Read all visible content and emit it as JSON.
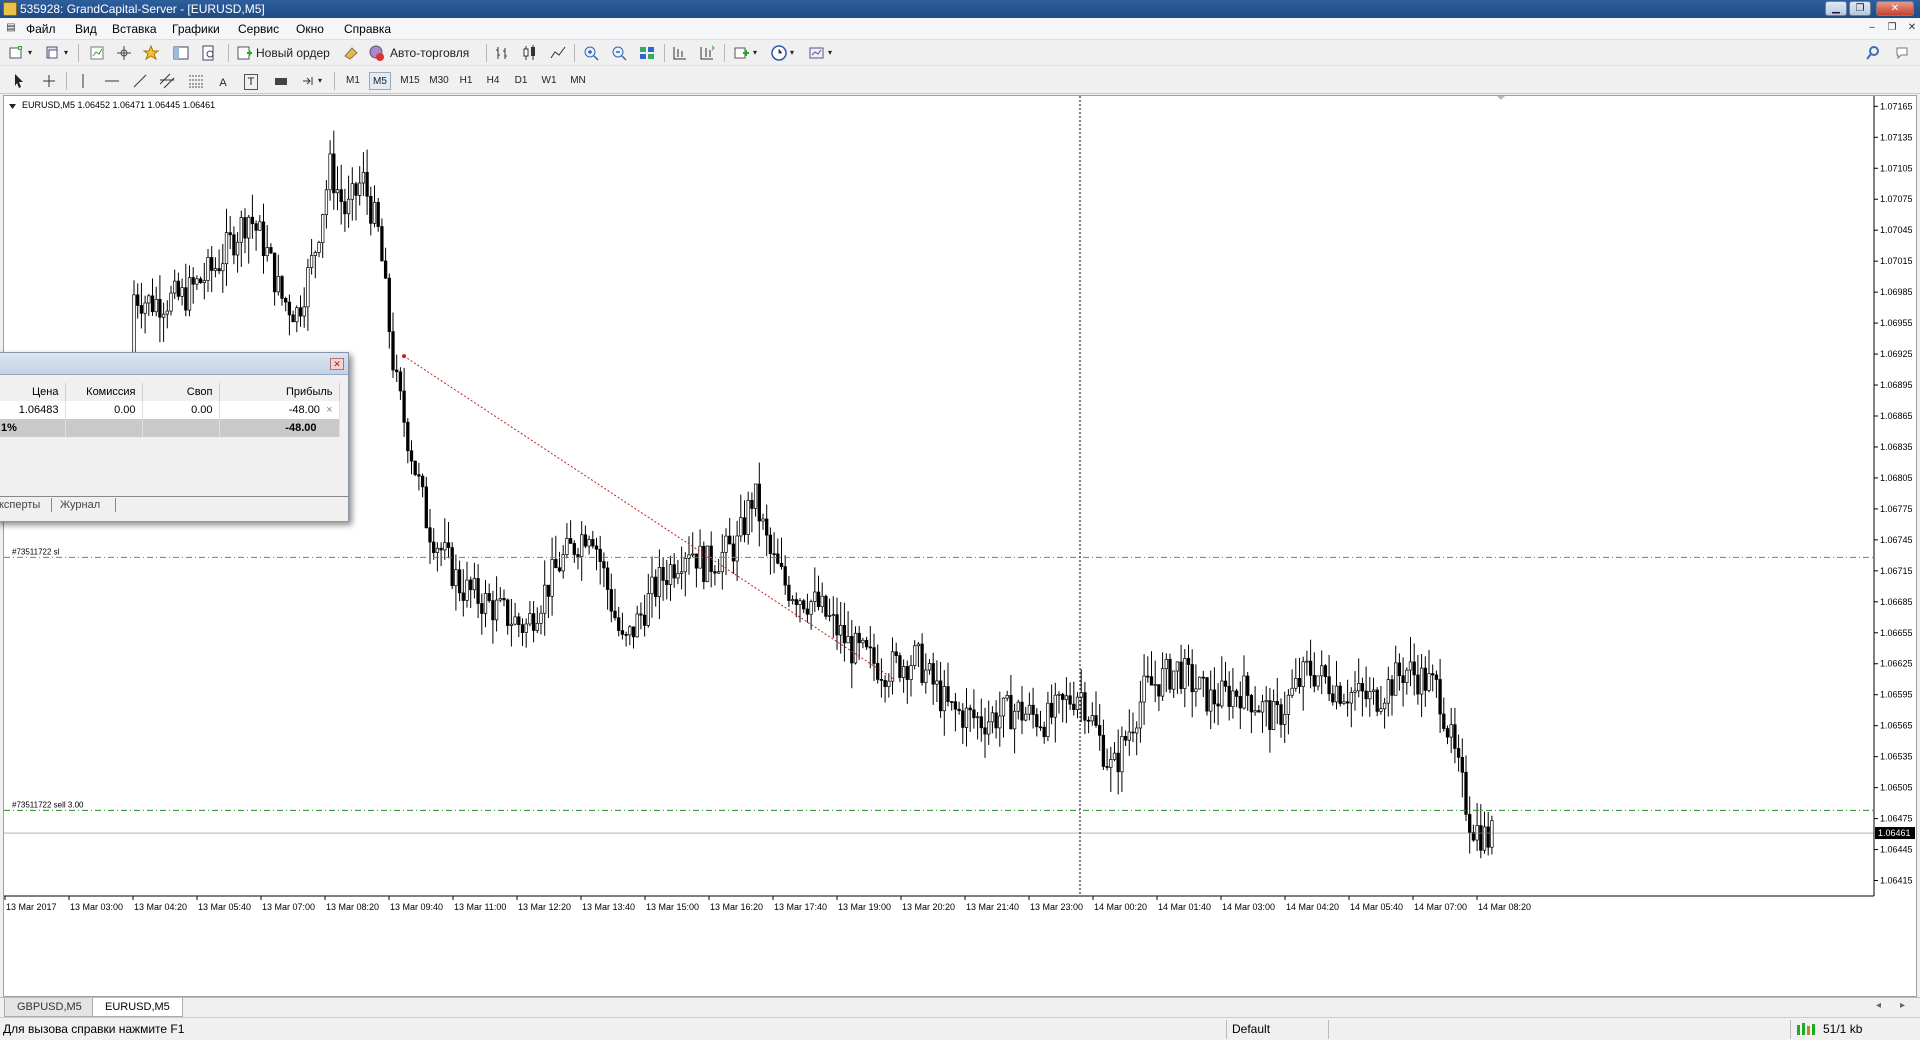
{
  "window": {
    "title": "535928: GrandCapital-Server - [EURUSD,M5]"
  },
  "menu": [
    "Файл",
    "Вид",
    "Вставка",
    "Графики",
    "Сервис",
    "Окно",
    "Справка"
  ],
  "toolbar": {
    "new_order": "Новый ордер",
    "auto_trading": "Авто-торговля"
  },
  "drawing_tools": {
    "text_a": "A",
    "text_t": "T"
  },
  "timeframes": [
    "M1",
    "M5",
    "M15",
    "M30",
    "H1",
    "H4",
    "D1",
    "W1",
    "MN"
  ],
  "active_timeframe": "M5",
  "chart": {
    "info": "EURUSD,M5  1.06452 1.06471 1.06445 1.06461",
    "sl_label": "#73511722 sl",
    "order_label": "#73511722 sell 3.00",
    "current_price": "1.06461"
  },
  "chart_data": {
    "type": "candlestick",
    "symbol": "EURUSD,M5",
    "ohlc": {
      "open": 1.06452,
      "high": 1.06471,
      "low": 1.06445,
      "close": 1.06461
    },
    "ylim": [
      1.064,
      1.07175
    ],
    "y_ticks": [
      "1.07165",
      "1.07135",
      "1.07105",
      "1.07075",
      "1.07045",
      "1.07015",
      "1.06985",
      "1.06955",
      "1.06925",
      "1.06895",
      "1.06865",
      "1.06835",
      "1.06805",
      "1.06775",
      "1.06745",
      "1.06715",
      "1.06685",
      "1.06655",
      "1.06625",
      "1.06595",
      "1.06565",
      "1.06535",
      "1.06505",
      "1.06475",
      "1.06445",
      "1.06415"
    ],
    "x_ticks": [
      "13 Mar 2017",
      "13 Mar 03:00",
      "13 Mar 04:20",
      "13 Mar 05:40",
      "13 Mar 07:00",
      "13 Mar 08:20",
      "13 Mar 09:40",
      "13 Mar 11:00",
      "13 Mar 12:20",
      "13 Mar 13:40",
      "13 Mar 15:00",
      "13 Mar 16:20",
      "13 Mar 17:40",
      "13 Mar 19:00",
      "13 Mar 20:20",
      "13 Mar 21:40",
      "13 Mar 23:00",
      "14 Mar 00:20",
      "14 Mar 01:40",
      "14 Mar 03:00",
      "14 Mar 04:20",
      "14 Mar 05:40",
      "14 Mar 07:00",
      "14 Mar 08:20"
    ],
    "sl_price": 1.06728,
    "order_price": 1.06483,
    "bid_price": 1.06461,
    "path": [
      [
        0,
        1.0687
      ],
      [
        0.02,
        1.0694
      ],
      [
        0.03,
        1.06985
      ],
      [
        0.05,
        1.0696
      ],
      [
        0.07,
        1.0699
      ],
      [
        0.09,
        1.06975
      ],
      [
        0.11,
        1.0698
      ],
      [
        0.13,
        1.0701
      ],
      [
        0.15,
        1.0706
      ],
      [
        0.16,
        1.0703
      ],
      [
        0.17,
        1.0698
      ],
      [
        0.18,
        1.06965
      ],
      [
        0.19,
        1.0702
      ],
      [
        0.2,
        1.07105
      ],
      [
        0.21,
        1.0706
      ],
      [
        0.22,
        1.07095
      ],
      [
        0.23,
        1.0704
      ],
      [
        0.24,
        1.069
      ],
      [
        0.26,
        1.0676
      ],
      [
        0.28,
        1.067
      ],
      [
        0.3,
        1.0668
      ],
      [
        0.32,
        1.0666
      ],
      [
        0.34,
        1.0672
      ],
      [
        0.36,
        1.0676
      ],
      [
        0.37,
        1.067
      ],
      [
        0.38,
        1.0664
      ],
      [
        0.4,
        1.067
      ],
      [
        0.42,
        1.0674
      ],
      [
        0.43,
        1.0672
      ],
      [
        0.45,
        1.0674
      ],
      [
        0.46,
        1.0679
      ],
      [
        0.47,
        1.0673
      ],
      [
        0.48,
        1.067
      ],
      [
        0.5,
        1.0668
      ],
      [
        0.52,
        1.0664
      ],
      [
        0.54,
        1.0662
      ],
      [
        0.56,
        1.0663
      ],
      [
        0.58,
        1.0658
      ],
      [
        0.6,
        1.0657
      ],
      [
        0.62,
        1.0658
      ],
      [
        0.64,
        1.0657
      ],
      [
        0.66,
        1.066
      ],
      [
        0.68,
        1.0652
      ],
      [
        0.7,
        1.066
      ],
      [
        0.72,
        1.0662
      ],
      [
        0.74,
        1.0659
      ],
      [
        0.76,
        1.066
      ],
      [
        0.78,
        1.0657
      ],
      [
        0.8,
        1.0662
      ],
      [
        0.82,
        1.066
      ],
      [
        0.84,
        1.0659
      ],
      [
        0.86,
        1.0662
      ],
      [
        0.88,
        1.066
      ],
      [
        0.9,
        1.0647
      ],
      [
        0.91,
        1.06455
      ],
      [
        0.915,
        1.06461
      ]
    ]
  },
  "terminal": {
    "columns": [
      "Цена",
      "Комиссия",
      "Своп",
      "Прибыль"
    ],
    "row": {
      "price": "1.06483",
      "commission": "0.00",
      "swap": "0.00",
      "profit": "-48.00",
      "close": "×"
    },
    "total_left": "1%",
    "total_profit": "-48.00",
    "tabs": [
      "ксперты",
      "Журнал"
    ]
  },
  "chart_tabs": [
    "GBPUSD,M5",
    "EURUSD,M5"
  ],
  "active_tab": "EURUSD,M5",
  "status": {
    "help": "Для вызова справки нажмите F1",
    "profile": "Default",
    "connection": "51/1 kb"
  },
  "colors": {
    "sl_line": "#e0542a",
    "order_line": "#2a8a2a",
    "trend_line": "#c02020",
    "crosshair": "#000000"
  }
}
